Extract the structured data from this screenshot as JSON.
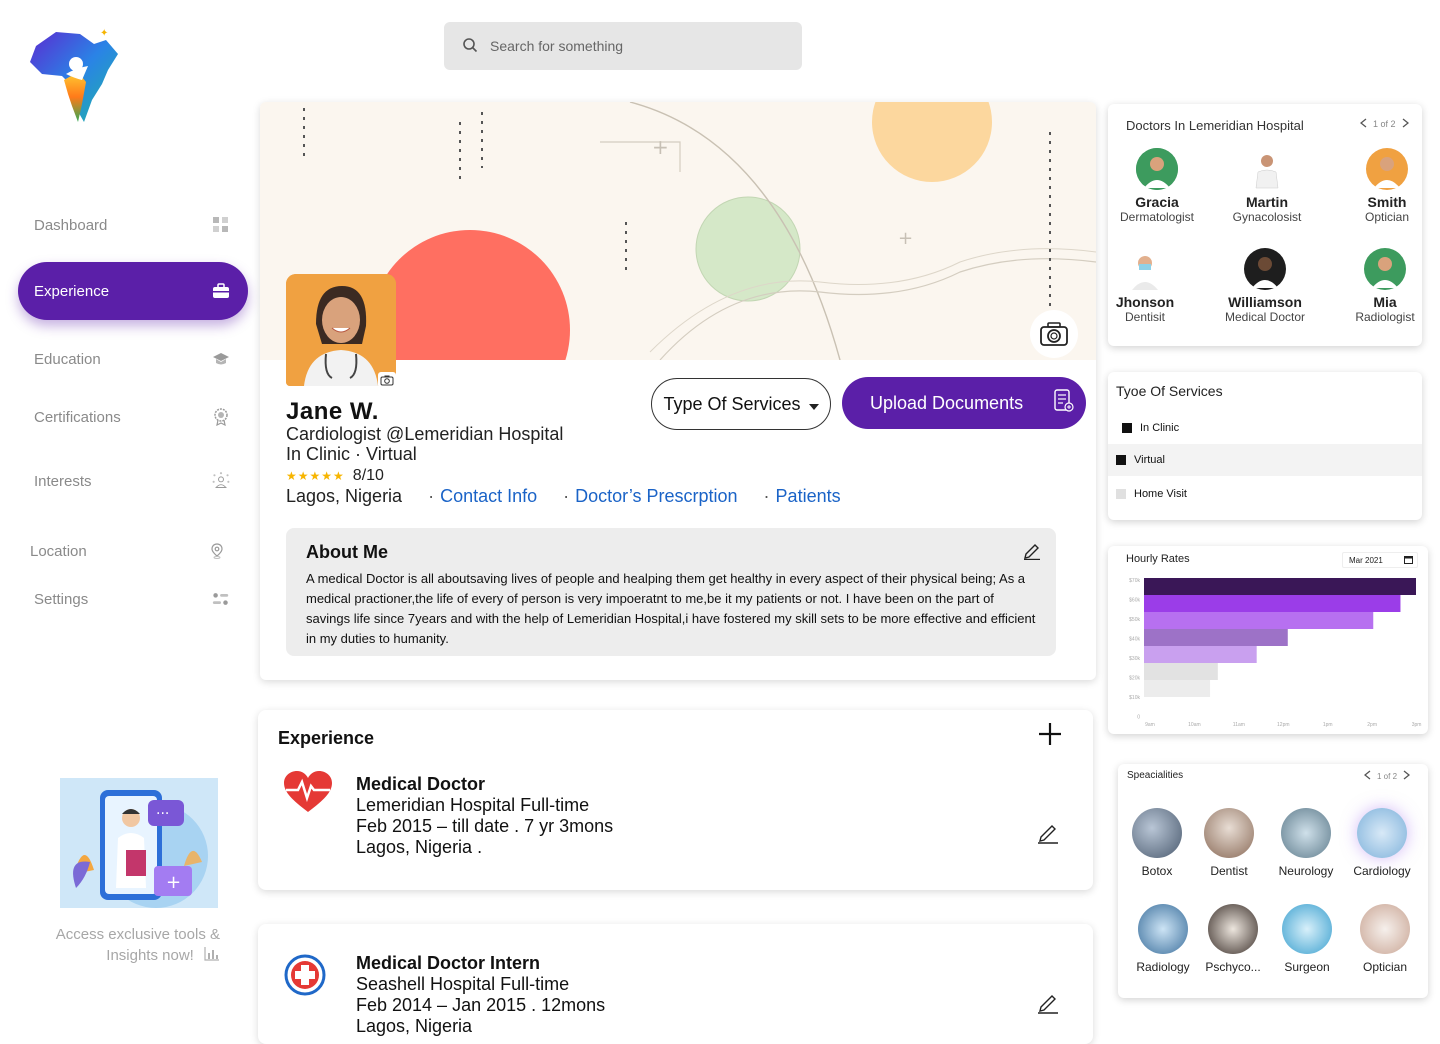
{
  "search": {
    "placeholder": "Search for something"
  },
  "sidebar": {
    "items": [
      {
        "label": "Dashboard",
        "icon": "grid-icon"
      },
      {
        "label": "Experience",
        "icon": "briefcase-icon",
        "active": true
      },
      {
        "label": "Education",
        "icon": "graduation-cap-icon"
      },
      {
        "label": "Certifications",
        "icon": "badge-icon"
      },
      {
        "label": "Interests",
        "icon": "interests-icon"
      },
      {
        "label": "Location",
        "icon": "location-pin-icon"
      },
      {
        "label": "Settings",
        "icon": "settings-toggle-icon"
      }
    ],
    "promo_text_line1": "Access exclusive tools &",
    "promo_text_line2": "Insights now!"
  },
  "profile": {
    "name": "Jane W.",
    "title": "Cardiologist @Lemeridian Hospital",
    "mode": "In Clinic  ·  Virtual",
    "rating": "8/10",
    "location": "Lagos, Nigeria",
    "links": [
      "Contact Info",
      "Doctor’s Prescrption",
      "Patients"
    ],
    "services_button": "Type Of Services",
    "upload_button": "Upload Documents",
    "about_title": "About Me",
    "about_text": "A medical Doctor is all aboutsaving lives of people and healping them get healthy in every aspect of their physical being; As a medical practioner,the life of every of  person is very impoeratnt to me,be it my patients or not. I have been on the part of savings life since 7years and with the help of Lemeridian Hospital,i have fostered my skill sets to be more effective and efficient in my duties to humanity."
  },
  "experience": {
    "title": "Experience",
    "entries": [
      {
        "role": "Medical Doctor",
        "place": "Lemeridian Hospital Full-time",
        "dates": "Feb 2015 – till date .  7 yr 3mons",
        "location": "Lagos, Nigeria ."
      },
      {
        "role": "Medical Doctor Intern",
        "place": "Seashell Hospital Full-time",
        "dates": "Feb 2014 –  Jan 2015 . 12mons",
        "location": "Lagos, Nigeria"
      }
    ]
  },
  "doctors_panel": {
    "title": "Doctors In Lemeridian Hospital",
    "pager": "1 of 2",
    "doctors": [
      {
        "name": "Gracia",
        "spec": "Dermatologist"
      },
      {
        "name": "Martin",
        "spec": "Gynacolosist"
      },
      {
        "name": "Smith",
        "spec": "Optician"
      },
      {
        "name": "Jhonson",
        "spec": "Dentisit"
      },
      {
        "name": "Williamson",
        "spec": "Medical Doctor"
      },
      {
        "name": "Mia",
        "spec": "Radiologist"
      }
    ]
  },
  "services_panel": {
    "title": "Tyoe Of Services",
    "options": [
      {
        "label": "In Clinic",
        "checked": true
      },
      {
        "label": "Virtual",
        "checked": true
      },
      {
        "label": "Home Visit",
        "checked": false
      }
    ]
  },
  "rates_panel": {
    "title": "Hourly Rates",
    "date_picker": "Mar 2021"
  },
  "chart_data": {
    "type": "bar",
    "orientation": "horizontal",
    "title": "Hourly Rates",
    "y_ticks": [
      "$70k",
      "$60k",
      "$50k",
      "$40k",
      "$30k",
      "$20k",
      "$10k",
      "0"
    ],
    "x_ticks": [
      "9am",
      "10am",
      "11am",
      "12pm",
      "1pm",
      "2pm",
      "3pm"
    ],
    "values": [
      70,
      66,
      59,
      37,
      29,
      19,
      17
    ],
    "colors": [
      "#3a1757",
      "#9b3de8",
      "#b770f0",
      "#9d72c7",
      "#c9a0ef",
      "#e2e2e2",
      "#ececec"
    ]
  },
  "specialities_panel": {
    "title": "Speacialities",
    "pager": "1 of 2",
    "items": [
      "Botox",
      "Dentist",
      "Neurology",
      "Cardiology",
      "Radiology",
      "Pschyco...",
      "Surgeon",
      "Optician"
    ]
  }
}
